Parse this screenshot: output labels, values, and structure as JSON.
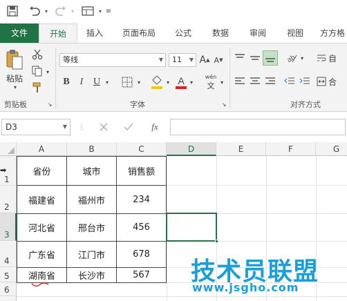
{
  "tabs": [
    "文件",
    "开始",
    "插入",
    "页面布局",
    "公式",
    "数据",
    "审阅",
    "视图",
    "方方格"
  ],
  "ribbon": {
    "clipboard": {
      "paste_label": "粘贴",
      "group_label": "剪贴板"
    },
    "font": {
      "font_name": "等线",
      "font_size": "11",
      "grow": "A",
      "shrink": "A",
      "bold": "B",
      "italic": "I",
      "underline": "U",
      "group_label": "字体",
      "phonetic": "wén"
    },
    "alignment": {
      "group_label": "对齐方式",
      "wrap_label": "自",
      "merge_label": "合"
    }
  },
  "formula_bar": {
    "name_box": "D3",
    "fx": "fx"
  },
  "columns": [
    "A",
    "B",
    "C",
    "D",
    "E",
    "F",
    "G"
  ],
  "rows": [
    "1",
    "2",
    "3",
    "4",
    "5",
    "6"
  ],
  "table": {
    "headers": [
      "省份",
      "城市",
      "销售额"
    ],
    "rows": [
      [
        "福建省",
        "福州市",
        "234"
      ],
      [
        "河北省",
        "邢台市",
        "456"
      ],
      [
        "广东省",
        "江门市",
        "678"
      ],
      [
        "湖南省",
        "长沙市",
        "567"
      ]
    ]
  },
  "watermark": {
    "title": "技术员联盟",
    "url": "www.jsgho.com"
  },
  "colors": {
    "accent": "#217346",
    "watermark": "#1c9fd9",
    "fill": "#f5c518",
    "font_color": "#e02020"
  }
}
